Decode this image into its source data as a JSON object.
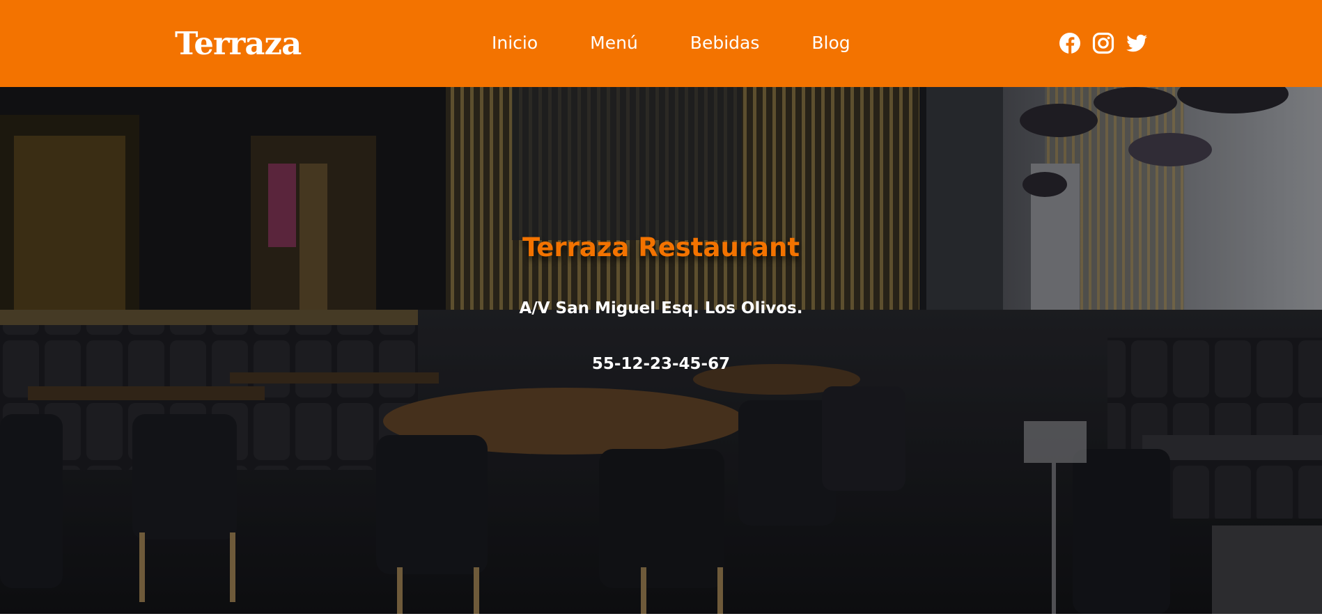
{
  "header": {
    "logo_text": "Terraza",
    "background_color": "#f37300",
    "nav": [
      {
        "label": "Inicio"
      },
      {
        "label": "Menú"
      },
      {
        "label": "Bebidas"
      },
      {
        "label": "Blog"
      }
    ],
    "social_icons": [
      "facebook-icon",
      "instagram-icon",
      "twitter-icon"
    ]
  },
  "hero": {
    "title": "Terraza Restaurant",
    "title_color": "#f37300",
    "address": "A/V San Miguel Esq. Los Olivos.",
    "phone": "55-12-23-45-67",
    "background_image": "restaurant-interior-photo"
  }
}
